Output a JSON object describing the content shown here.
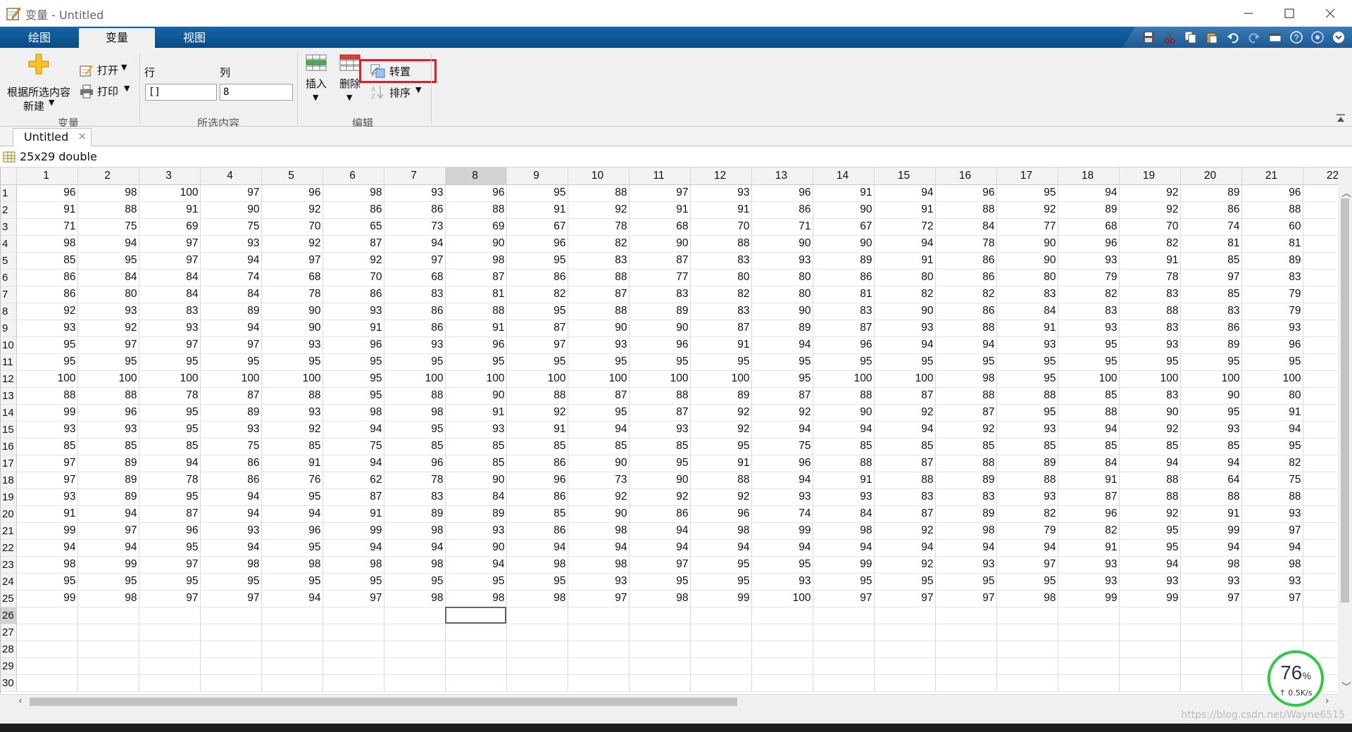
{
  "window": {
    "title": "变量 - Untitled"
  },
  "tabs": [
    {
      "label": "绘图"
    },
    {
      "label": "变量"
    },
    {
      "label": "视图"
    }
  ],
  "ribbon": {
    "new_from_selection": "根据所选内容",
    "new_label": "新建",
    "open": "打开",
    "print": "打印",
    "row_label": "行",
    "col_label": "列",
    "row_value": "[]",
    "col_value": "8",
    "insert": "插入",
    "delete": "删除",
    "transpose": "转置",
    "sort": "排序",
    "group_variable": "变量",
    "group_selection": "所选内容",
    "group_edit": "编辑"
  },
  "document": {
    "tab": "Untitled",
    "close": "✕",
    "variable_info": "25x29 double"
  },
  "grid": {
    "columns": [
      "1",
      "2",
      "3",
      "4",
      "5",
      "6",
      "7",
      "8",
      "9",
      "10",
      "11",
      "12",
      "13",
      "14",
      "15",
      "16",
      "17",
      "18",
      "19",
      "20",
      "21",
      "22"
    ],
    "row_headers": [
      "1",
      "2",
      "3",
      "4",
      "5",
      "6",
      "7",
      "8",
      "9",
      "10",
      "11",
      "12",
      "13",
      "14",
      "15",
      "16",
      "17",
      "18",
      "19",
      "20",
      "21",
      "22",
      "23",
      "24",
      "25",
      "26",
      "27",
      "28",
      "29",
      "30"
    ],
    "selected_column": 8,
    "selected_row": 26,
    "rows": [
      [
        96,
        98,
        100,
        97,
        96,
        98,
        93,
        96,
        95,
        88,
        97,
        93,
        96,
        91,
        94,
        96,
        95,
        94,
        92,
        89,
        96
      ],
      [
        91,
        88,
        91,
        90,
        92,
        86,
        86,
        88,
        91,
        92,
        91,
        91,
        86,
        90,
        91,
        88,
        92,
        89,
        92,
        86,
        88
      ],
      [
        71,
        75,
        69,
        75,
        70,
        65,
        73,
        69,
        67,
        78,
        68,
        70,
        71,
        67,
        72,
        84,
        77,
        68,
        70,
        74,
        60
      ],
      [
        98,
        94,
        97,
        93,
        92,
        87,
        94,
        90,
        96,
        82,
        90,
        88,
        90,
        90,
        94,
        78,
        90,
        96,
        82,
        81,
        81
      ],
      [
        85,
        95,
        97,
        94,
        97,
        92,
        97,
        98,
        95,
        83,
        87,
        83,
        93,
        89,
        91,
        86,
        90,
        93,
        91,
        85,
        89
      ],
      [
        86,
        84,
        84,
        74,
        68,
        70,
        68,
        87,
        86,
        88,
        77,
        80,
        80,
        86,
        80,
        86,
        80,
        79,
        78,
        97,
        83
      ],
      [
        86,
        80,
        84,
        84,
        78,
        86,
        83,
        81,
        82,
        87,
        83,
        82,
        80,
        81,
        82,
        82,
        83,
        82,
        83,
        85,
        79
      ],
      [
        92,
        93,
        83,
        89,
        90,
        93,
        86,
        88,
        95,
        88,
        89,
        83,
        90,
        83,
        90,
        86,
        84,
        83,
        88,
        83,
        79
      ],
      [
        93,
        92,
        93,
        94,
        90,
        91,
        86,
        91,
        87,
        90,
        90,
        87,
        89,
        87,
        93,
        88,
        91,
        93,
        83,
        86,
        93
      ],
      [
        95,
        97,
        97,
        97,
        93,
        96,
        93,
        96,
        97,
        93,
        96,
        91,
        94,
        96,
        94,
        94,
        93,
        95,
        93,
        89,
        96
      ],
      [
        95,
        95,
        95,
        95,
        95,
        95,
        95,
        95,
        95,
        95,
        95,
        95,
        95,
        95,
        95,
        95,
        95,
        95,
        95,
        95,
        95
      ],
      [
        100,
        100,
        100,
        100,
        100,
        95,
        100,
        100,
        100,
        100,
        100,
        100,
        95,
        100,
        100,
        98,
        95,
        100,
        100,
        100,
        100
      ],
      [
        88,
        88,
        78,
        87,
        88,
        95,
        88,
        90,
        88,
        87,
        88,
        89,
        87,
        88,
        87,
        88,
        88,
        85,
        83,
        90,
        80
      ],
      [
        99,
        96,
        95,
        89,
        93,
        98,
        98,
        91,
        92,
        95,
        87,
        92,
        92,
        90,
        92,
        87,
        95,
        88,
        90,
        95,
        91
      ],
      [
        93,
        93,
        95,
        93,
        92,
        94,
        95,
        93,
        91,
        94,
        93,
        92,
        94,
        94,
        94,
        92,
        93,
        94,
        92,
        93,
        94
      ],
      [
        85,
        85,
        85,
        75,
        85,
        75,
        85,
        85,
        85,
        85,
        85,
        95,
        75,
        85,
        85,
        85,
        85,
        85,
        85,
        85,
        95
      ],
      [
        97,
        89,
        94,
        86,
        91,
        94,
        96,
        85,
        86,
        90,
        95,
        91,
        96,
        88,
        87,
        88,
        89,
        84,
        94,
        94,
        82
      ],
      [
        97,
        89,
        78,
        86,
        76,
        62,
        78,
        90,
        96,
        73,
        90,
        88,
        94,
        91,
        88,
        89,
        88,
        91,
        88,
        64,
        75
      ],
      [
        93,
        89,
        95,
        94,
        95,
        87,
        83,
        84,
        86,
        92,
        92,
        92,
        93,
        93,
        83,
        83,
        93,
        87,
        88,
        88,
        88
      ],
      [
        91,
        94,
        87,
        94,
        94,
        91,
        89,
        89,
        85,
        90,
        86,
        96,
        74,
        84,
        87,
        89,
        82,
        96,
        92,
        91,
        93
      ],
      [
        99,
        97,
        96,
        93,
        96,
        99,
        98,
        93,
        86,
        98,
        94,
        98,
        99,
        98,
        92,
        98,
        79,
        82,
        95,
        99,
        97
      ],
      [
        94,
        94,
        95,
        94,
        95,
        94,
        94,
        90,
        94,
        94,
        94,
        94,
        94,
        94,
        94,
        94,
        94,
        91,
        95,
        94,
        94
      ],
      [
        98,
        99,
        97,
        98,
        98,
        98,
        98,
        94,
        98,
        98,
        97,
        95,
        95,
        99,
        92,
        93,
        97,
        93,
        94,
        98,
        98
      ],
      [
        95,
        95,
        95,
        95,
        95,
        95,
        95,
        95,
        95,
        93,
        95,
        95,
        93,
        95,
        95,
        95,
        95,
        93,
        93,
        93,
        93
      ],
      [
        99,
        98,
        97,
        97,
        94,
        97,
        98,
        98,
        98,
        97,
        98,
        99,
        100,
        97,
        97,
        97,
        98,
        99,
        99,
        97,
        97
      ]
    ]
  },
  "net_widget": {
    "percent": "76",
    "unit": "%",
    "speed": "↑ 0.5K/s"
  },
  "watermark": "https://blog.csdn.net/Wayne6515",
  "colors": {
    "ribbon_blue": "#084c86",
    "highlight": "#e21b2b",
    "selection": "#d2d2d2"
  }
}
